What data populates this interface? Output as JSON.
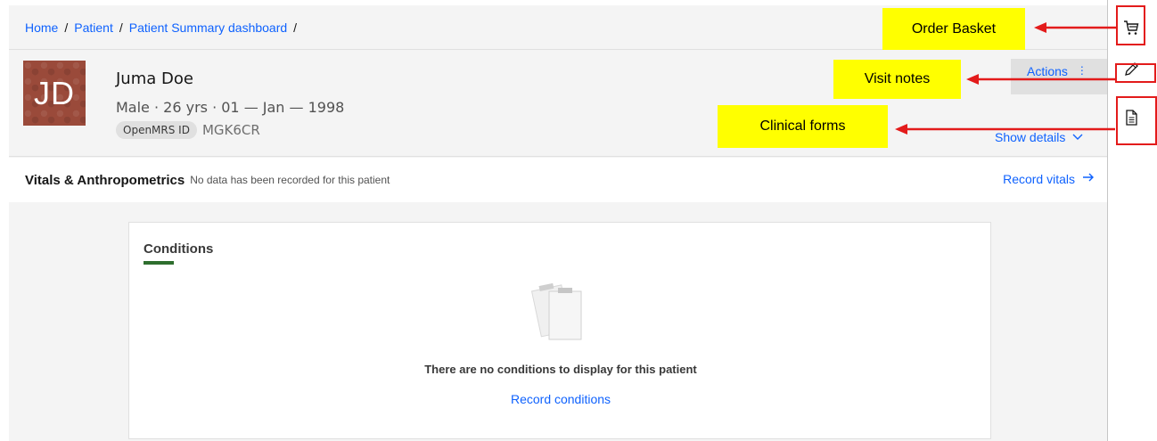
{
  "breadcrumb": {
    "items": [
      "Home",
      "Patient",
      "Patient Summary dashboard"
    ],
    "separator": "/"
  },
  "patient": {
    "initials": "JD",
    "name": "Juma Doe",
    "demographics": "Male · 26 yrs · 01 — Jan — 1998",
    "id_label": "OpenMRS ID",
    "id_value": "MGK6CR"
  },
  "banner": {
    "actions_label": "Actions",
    "show_details_label": "Show details"
  },
  "vitals": {
    "title": "Vitals & Anthropometrics",
    "message": "No data has been recorded for this patient",
    "record_label": "Record vitals"
  },
  "conditions": {
    "title": "Conditions",
    "empty_message": "There are no conditions to display for this patient",
    "record_label": "Record conditions"
  },
  "annotations": {
    "order_basket": "Order Basket",
    "visit_notes": "Visit notes",
    "clinical_forms": "Clinical forms"
  },
  "sidebar": {
    "icons": [
      "cart-icon",
      "pencil-icon",
      "document-icon"
    ]
  },
  "colors": {
    "link": "#0f62fe",
    "annotation_fill": "#ffff00",
    "annotation_arrow": "#e31b1b",
    "conditions_accent": "#2e6e2e",
    "avatar": "#9a4a3a"
  }
}
